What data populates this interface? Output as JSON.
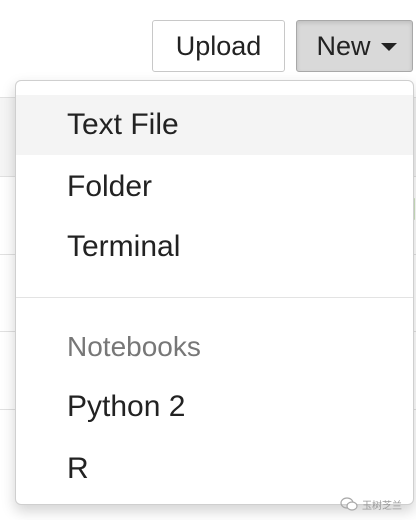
{
  "toolbar": {
    "upload_label": "Upload",
    "new_label": "New"
  },
  "new_menu": {
    "items": [
      {
        "label": "Text File"
      },
      {
        "label": "Folder"
      },
      {
        "label": "Terminal"
      }
    ],
    "notebooks_header": "Notebooks",
    "notebook_items": [
      {
        "label": "Python 2"
      },
      {
        "label": "R"
      }
    ]
  },
  "watermark": {
    "text": "玉树芝兰"
  },
  "colors": {
    "menu_hover_bg": "#f4f4f4",
    "new_button_bg": "#d9d9d9",
    "header_text": "#777777",
    "accent_green": "#cfe6c2"
  }
}
